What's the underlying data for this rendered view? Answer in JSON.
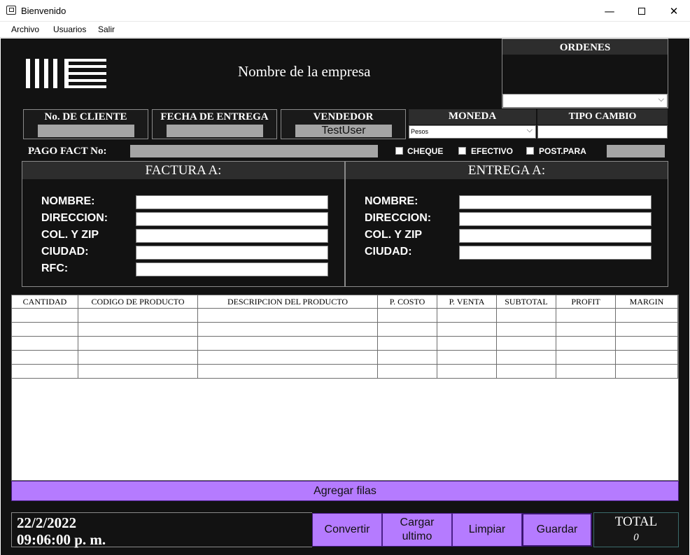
{
  "window": {
    "title": "Bienvenido",
    "min_glyph": "—",
    "max_glyph": "☐",
    "close_glyph": "✕"
  },
  "menu": [
    "Archivo",
    "Usuarios",
    "Salir"
  ],
  "company_name": "Nombre de la empresa",
  "ordenes": {
    "title": "ORDENES",
    "select_value": ""
  },
  "header_fields": {
    "cliente": {
      "label": "No. DE CLIENTE",
      "value": ""
    },
    "fecha": {
      "label": "FECHA DE ENTREGA",
      "value": ""
    },
    "vendedor": {
      "label": "VENDEDOR",
      "value": "TestUser"
    },
    "moneda": {
      "label": "MONEDA",
      "value": "Pesos"
    },
    "tipo_cambio": {
      "label": "TIPO CAMBIO",
      "value": ""
    }
  },
  "pago": {
    "label": "PAGO FACT No:",
    "value": "",
    "checks": [
      {
        "label": "CHEQUE",
        "checked": false
      },
      {
        "label": "EFECTIVO",
        "checked": false
      },
      {
        "label": "POST.PARA",
        "checked": false
      }
    ]
  },
  "factura": {
    "title": "FACTURA A:",
    "fields": [
      "NOMBRE:",
      "DIRECCION:",
      "COL. Y ZIP",
      "CIUDAD:",
      "RFC:"
    ]
  },
  "entrega": {
    "title": "ENTREGA A:",
    "fields": [
      "NOMBRE:",
      "DIRECCION:",
      "COL. Y ZIP",
      "CIUDAD:"
    ]
  },
  "table": {
    "columns": [
      "CANTIDAD",
      "CODIGO DE PRODUCTO",
      "DESCRIPCION DEL PRODUCTO",
      "P. COSTO",
      "P. VENTA",
      "SUBTOTAL",
      "PROFIT",
      "MARGIN"
    ],
    "row_count": 5
  },
  "agregar_filas": "Agregar filas",
  "date": "22/2/2022",
  "time": "09:06:00 p. m.",
  "buttons": {
    "convertir": "Convertir",
    "cargar_line1": "Cargar",
    "cargar_line2": "ultimo",
    "limpiar": "Limpiar",
    "guardar": "Guardar"
  },
  "total": {
    "label": "TOTAL",
    "value": "0"
  },
  "colors": {
    "accent": "#b57bff",
    "background": "#121212",
    "field_gray": "#a5a5a5"
  }
}
